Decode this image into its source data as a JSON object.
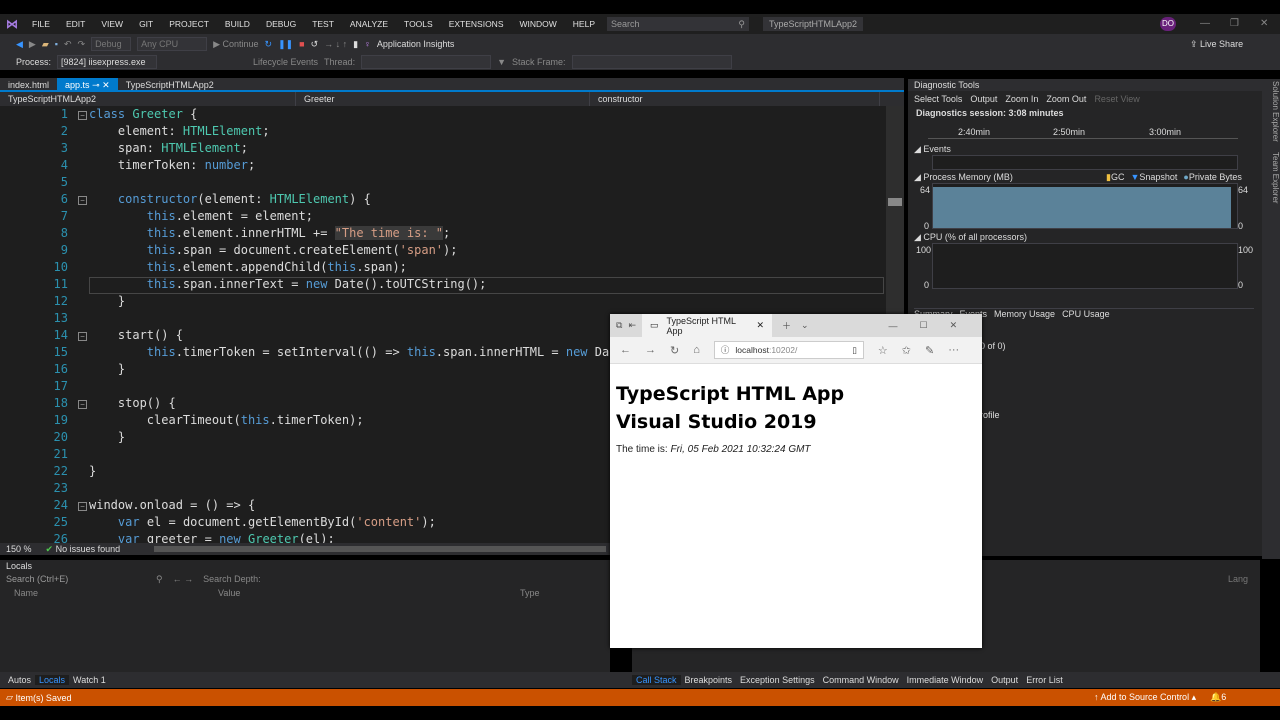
{
  "menu": [
    "FILE",
    "EDIT",
    "VIEW",
    "GIT",
    "PROJECT",
    "BUILD",
    "DEBUG",
    "TEST",
    "ANALYZE",
    "TOOLS",
    "EXTENSIONS",
    "WINDOW",
    "HELP"
  ],
  "search_placeholder": "Search",
  "project_name": "TypeScriptHTMLApp2",
  "user_initials": "DO",
  "toolbar": {
    "config": "Debug",
    "platform": "Any CPU",
    "continue": "Continue",
    "app_insights": "Application Insights",
    "live_share": "Live Share"
  },
  "toolbar2": {
    "process_label": "Process:",
    "process": "[9824] iisexpress.exe",
    "lifecycle": "Lifecycle Events",
    "thread": "Thread:",
    "stack_frame": "Stack Frame:"
  },
  "tabs": [
    "index.html",
    "app.ts",
    "TypeScriptHTMLApp2"
  ],
  "navbar": {
    "project": "TypeScriptHTMLApp2",
    "class": "Greeter",
    "member": "constructor"
  },
  "code": [
    [
      [
        "k",
        "class "
      ],
      [
        "t",
        "Greeter"
      ],
      [
        "p",
        " {"
      ]
    ],
    [
      [
        "p",
        "    element: "
      ],
      [
        "t",
        "HTMLElement"
      ],
      [
        "p",
        ";"
      ]
    ],
    [
      [
        "p",
        "    span: "
      ],
      [
        "t",
        "HTMLElement"
      ],
      [
        "p",
        ";"
      ]
    ],
    [
      [
        "p",
        "    timerToken: "
      ],
      [
        "k",
        "number"
      ],
      [
        "p",
        ";"
      ]
    ],
    [],
    [
      [
        "p",
        "    "
      ],
      [
        "k",
        "constructor"
      ],
      [
        "p",
        "(element: "
      ],
      [
        "t",
        "HTMLElement"
      ],
      [
        "p",
        ") {"
      ]
    ],
    [
      [
        "p",
        "        "
      ],
      [
        "k",
        "this"
      ],
      [
        "p",
        ".element = element;"
      ]
    ],
    [
      [
        "p",
        "        "
      ],
      [
        "k",
        "this"
      ],
      [
        "p",
        ".element.innerHTML += "
      ],
      [
        "s",
        "\"The time is: \""
      ],
      [
        "p",
        ";"
      ]
    ],
    [
      [
        "p",
        "        "
      ],
      [
        "k",
        "this"
      ],
      [
        "p",
        ".span = document.createElement("
      ],
      [
        "s",
        "'span'"
      ],
      [
        "p",
        ");"
      ]
    ],
    [
      [
        "p",
        "        "
      ],
      [
        "k",
        "this"
      ],
      [
        "p",
        ".element.appendChild("
      ],
      [
        "k",
        "this"
      ],
      [
        "p",
        ".span);"
      ]
    ],
    [
      [
        "p",
        "        "
      ],
      [
        "k",
        "this"
      ],
      [
        "p",
        ".span.innerText = "
      ],
      [
        "k",
        "new"
      ],
      [
        "p",
        " Date().toUTCString();"
      ]
    ],
    [
      [
        "p",
        "    }"
      ]
    ],
    [],
    [
      [
        "p",
        "    start() {"
      ]
    ],
    [
      [
        "p",
        "        "
      ],
      [
        "k",
        "this"
      ],
      [
        "p",
        ".timerToken = setInterval(() => "
      ],
      [
        "k",
        "this"
      ],
      [
        "p",
        ".span.innerHTML = "
      ],
      [
        "k",
        "new"
      ],
      [
        "p",
        " Date().toUTCString(), 500);"
      ]
    ],
    [
      [
        "p",
        "    }"
      ]
    ],
    [],
    [
      [
        "p",
        "    stop() {"
      ]
    ],
    [
      [
        "p",
        "        clearTimeout("
      ],
      [
        "k",
        "this"
      ],
      [
        "p",
        ".timerToken);"
      ]
    ],
    [
      [
        "p",
        "    }"
      ]
    ],
    [],
    [
      [
        "p",
        "}"
      ]
    ],
    [],
    [
      [
        "p",
        "window.onload = () => {"
      ]
    ],
    [
      [
        "p",
        "    "
      ],
      [
        "k",
        "var"
      ],
      [
        "p",
        " el = document.getElementById("
      ],
      [
        "s",
        "'content'"
      ],
      [
        "p",
        ");"
      ]
    ],
    [
      [
        "p",
        "    "
      ],
      [
        "k",
        "var"
      ],
      [
        "p",
        " greeter = "
      ],
      [
        "k",
        "new"
      ],
      [
        "p",
        " "
      ],
      [
        "t",
        "Greeter"
      ],
      [
        "p",
        "(el);"
      ]
    ]
  ],
  "editor_status": {
    "zoom": "150 %",
    "issues": "No issues found"
  },
  "locals": {
    "title": "Locals",
    "search": "Search (Ctrl+E)",
    "search_depth": "Search Depth:",
    "cols": [
      "Name",
      "Value",
      "Type"
    ]
  },
  "bottom_tabs_left": [
    "Autos",
    "Locals",
    "Watch 1"
  ],
  "bottom_tabs_right": [
    "Call Stack",
    "Breakpoints",
    "Exception Settings",
    "Command Window",
    "Immediate Window",
    "Output",
    "Error List"
  ],
  "status": {
    "message": "Item(s) Saved",
    "source_control": "Add to Source Control",
    "notifications": "6"
  },
  "diag": {
    "title": "Diagnostic Tools",
    "tools": [
      "Select Tools",
      "Output",
      "Zoom In",
      "Zoom Out",
      "Reset View"
    ],
    "session": "Diagnostics session: 3:08 minutes",
    "ticks": [
      "2:40min",
      "2:50min",
      "3:00min"
    ],
    "events": "Events",
    "memory": "Process Memory (MB)",
    "legend": [
      "GC",
      "Snapshot",
      "Private Bytes"
    ],
    "mem_max": "64",
    "mem_min": "0",
    "cpu": "CPU (% of all processors)",
    "cpu_max": "100",
    "cpu_min": "0",
    "subtabs": [
      "Summary",
      "Events",
      "Memory Usage",
      "CPU Usage"
    ],
    "rows": [
      "0 of 0)",
      "rofile"
    ],
    "lang": "Lang",
    "memory_fill_pct": 93
  },
  "side": [
    "Solution Explorer",
    "Team Explorer"
  ],
  "browser": {
    "tab_title": "TypeScript HTML App",
    "url_host": "localhost",
    "url_port": ":10202/",
    "heading1": "TypeScript HTML App",
    "heading2": "Visual Studio 2019",
    "time_label": "The time is: ",
    "time_value": "Fri, 05 Feb 2021 10:32:24 GMT"
  },
  "colors": {
    "accent": "#007acc",
    "statusbar": "#ca5100",
    "memory": "#5b8299"
  }
}
